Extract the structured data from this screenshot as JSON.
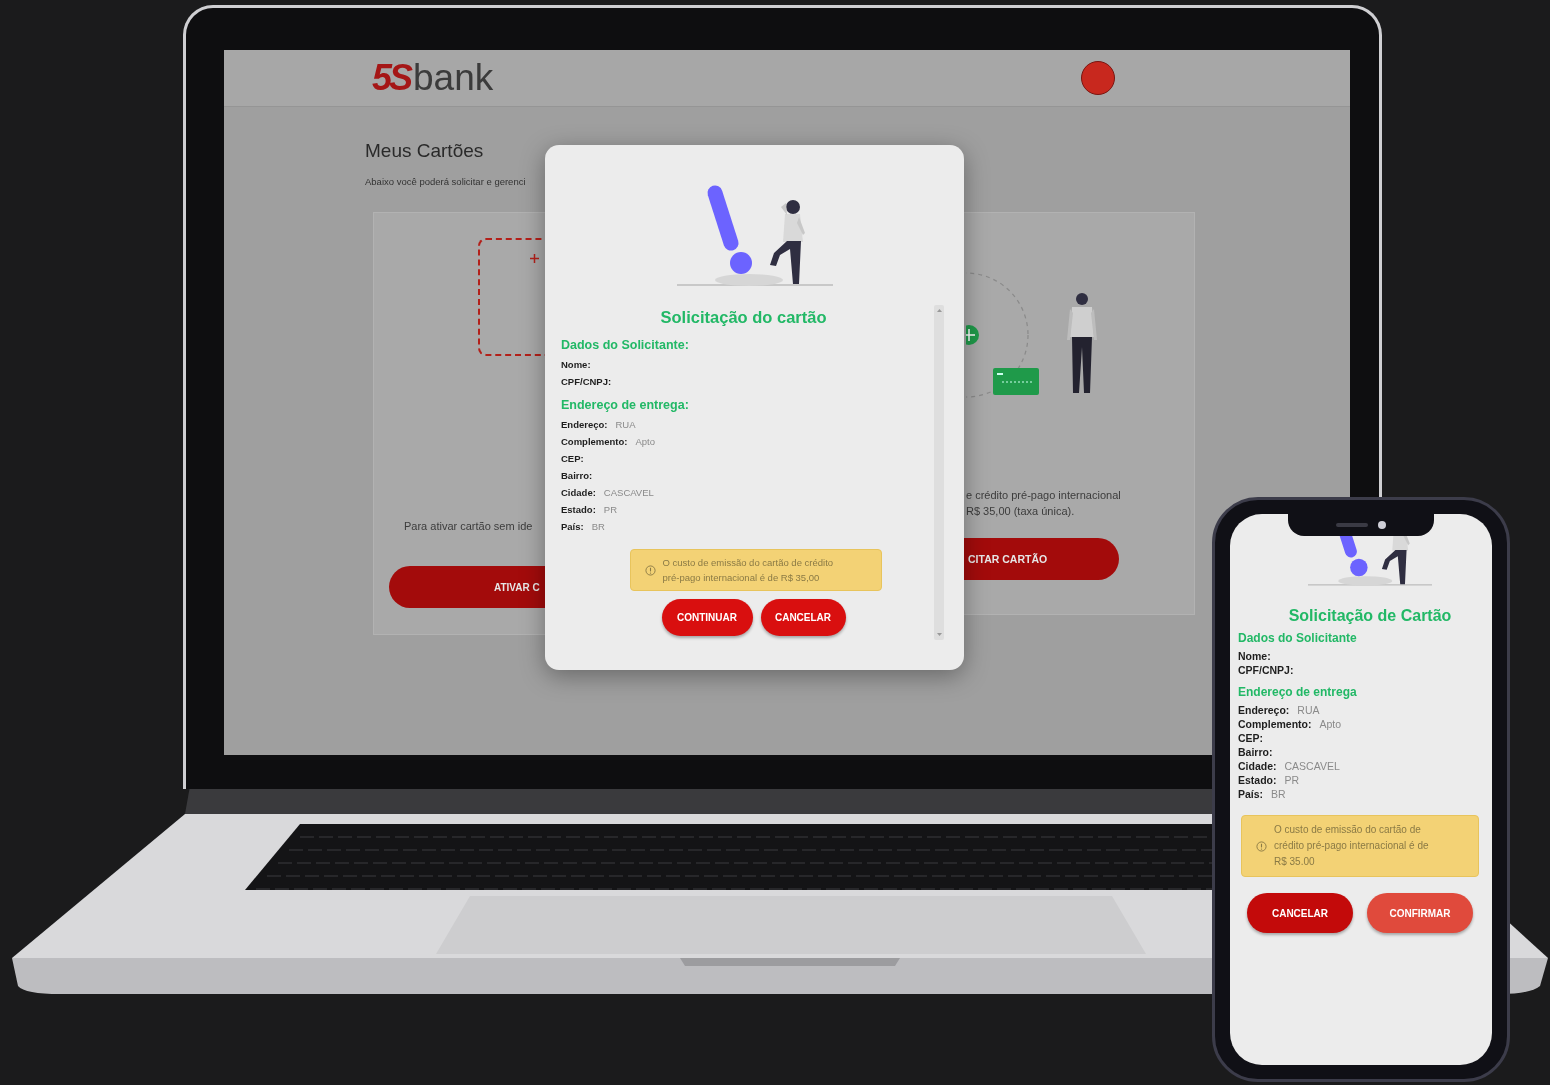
{
  "laptop_screen": {
    "header": {
      "logo_mark": "5S",
      "logo_word": "bank"
    },
    "page": {
      "title": "Meus Cartões",
      "subtitle": "Abaixo você poderá solicitar e gerenci"
    },
    "left_card": {
      "text": "Para ativar cartão sem ide",
      "button": "ATIVAR C"
    },
    "right_card": {
      "text_lines": [
        "e crédito pré-pago internacional",
        "R$  35,00 (taxa única)."
      ],
      "button": "CITAR CARTÃO"
    },
    "modal": {
      "title": "Solicitação do cartão",
      "sections": [
        {
          "heading": "Dados do Solicitante:",
          "fields": [
            {
              "label": "Nome:"
            },
            {
              "label": "CPF/CNPJ:"
            }
          ]
        },
        {
          "heading": "Endereço de entrega:",
          "fields": [
            {
              "label": "Endereço:",
              "value": "RUA"
            },
            {
              "label": "Complemento:",
              "value": "Apto"
            },
            {
              "label": "CEP:"
            },
            {
              "label": "Bairro:"
            },
            {
              "label": "Cidade:",
              "value": "CASCAVEL"
            },
            {
              "label": "Estado:",
              "value": "PR"
            },
            {
              "label": "País:",
              "value": "BR"
            }
          ]
        }
      ],
      "notice_lines": [
        "O custo de emissão do cartão de crédito",
        "pré-pago internacional é de R$  35,00"
      ],
      "buttons": [
        {
          "label": "CONTINUAR",
          "kind": "primary"
        },
        {
          "label": "CANCELAR",
          "kind": "primary"
        }
      ]
    }
  },
  "phone_screen": {
    "title": "Solicitação de Cartão",
    "sections": [
      {
        "heading": "Dados do Solicitante",
        "fields": [
          {
            "label": "Nome:"
          },
          {
            "label": "CPF/CNPJ:"
          }
        ]
      },
      {
        "heading": "Endereço de entrega",
        "fields": [
          {
            "label": "Endereço:",
            "value": "RUA"
          },
          {
            "label": "Complemento:",
            "value": "Apto"
          },
          {
            "label": "CEP:"
          },
          {
            "label": "Bairro:"
          },
          {
            "label": "Cidade:",
            "value": "CASCAVEL"
          },
          {
            "label": "Estado:",
            "value": "PR"
          },
          {
            "label": "País:",
            "value": "BR"
          }
        ]
      }
    ],
    "notice_lines": [
      "O custo de emissão do cartão de",
      "crédito pré-pago internacional é de",
      "R$  35.00"
    ],
    "buttons": [
      {
        "label": "CANCELAR",
        "kind": "primary"
      },
      {
        "label": "CONFIRMAR",
        "kind": "secondary"
      }
    ]
  }
}
